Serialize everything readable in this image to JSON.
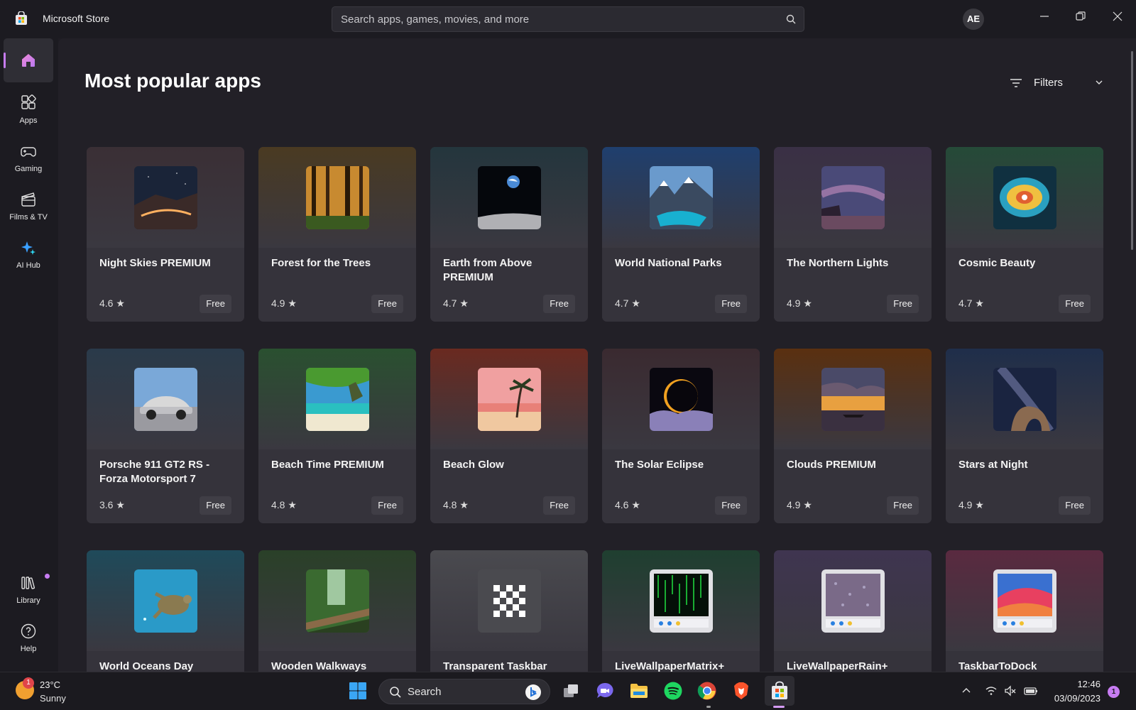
{
  "app": {
    "title": "Microsoft Store",
    "search_placeholder": "Search apps, games, movies, and more",
    "user_initials": "AE"
  },
  "sidebar": {
    "items": [
      {
        "label": "",
        "icon": "home-icon",
        "active": true
      },
      {
        "label": "Apps",
        "icon": "apps-icon"
      },
      {
        "label": "Gaming",
        "icon": "gamepad-icon"
      },
      {
        "label": "Films & TV",
        "icon": "film-icon"
      },
      {
        "label": "AI Hub",
        "icon": "sparkle-icon"
      }
    ],
    "bottom_items": [
      {
        "label": "Library",
        "icon": "library-icon"
      },
      {
        "label": "Help",
        "icon": "help-icon"
      }
    ],
    "accent": "#c77cf2"
  },
  "main": {
    "title": "Most popular apps",
    "filters_label": "Filters",
    "cards": [
      {
        "name": "Night Skies PREMIUM",
        "rating": "4.6",
        "price": "Free",
        "thumb": "night-skies-thumb",
        "bg": "#3a2f35"
      },
      {
        "name": "Forest for the Trees",
        "rating": "4.9",
        "price": "Free",
        "thumb": "forest-thumb",
        "bg": "#4a3a22"
      },
      {
        "name": "Earth from Above PREMIUM",
        "rating": "4.7",
        "price": "Free",
        "thumb": "earth-thumb",
        "bg": "#24363d"
      },
      {
        "name": "World National Parks",
        "rating": "4.7",
        "price": "Free",
        "thumb": "national-parks-thumb",
        "bg": "#1f3f6e"
      },
      {
        "name": "The Northern Lights",
        "rating": "4.9",
        "price": "Free",
        "thumb": "northern-lights-thumb",
        "bg": "#3a3045"
      },
      {
        "name": "Cosmic Beauty",
        "rating": "4.7",
        "price": "Free",
        "thumb": "cosmic-thumb",
        "bg": "#254a38"
      },
      {
        "name": "Porsche 911 GT2 RS - Forza Motorsport 7",
        "rating": "3.6",
        "price": "Free",
        "thumb": "porsche-thumb",
        "bg": "#2a3a4a"
      },
      {
        "name": "Beach Time PREMIUM",
        "rating": "4.8",
        "price": "Free",
        "thumb": "beach-time-thumb",
        "bg": "#2a5030"
      },
      {
        "name": "Beach Glow",
        "rating": "4.8",
        "price": "Free",
        "thumb": "beach-glow-thumb",
        "bg": "#6a2a20"
      },
      {
        "name": "The Solar Eclipse",
        "rating": "4.6",
        "price": "Free",
        "thumb": "solar-eclipse-thumb",
        "bg": "#3a2a30"
      },
      {
        "name": "Clouds PREMIUM",
        "rating": "4.9",
        "price": "Free",
        "thumb": "clouds-thumb",
        "bg": "#5a3010"
      },
      {
        "name": "Stars at Night",
        "rating": "4.9",
        "price": "Free",
        "thumb": "stars-thumb",
        "bg": "#1f2e4a"
      },
      {
        "name": "World Oceans Day",
        "rating": "",
        "price": "",
        "thumb": "oceans-thumb",
        "bg": "#1f4a5a"
      },
      {
        "name": "Wooden Walkways",
        "rating": "",
        "price": "",
        "thumb": "walkways-thumb",
        "bg": "#2a4028"
      },
      {
        "name": "Transparent Taskbar",
        "rating": "",
        "price": "",
        "thumb": "checker-thumb",
        "bg": "#4a4a4f"
      },
      {
        "name": "LiveWallpaperMatrix+",
        "rating": "",
        "price": "",
        "thumb": "matrix-thumb",
        "bg": "#1f3f30"
      },
      {
        "name": "LiveWallpaperRain+",
        "rating": "",
        "price": "",
        "thumb": "rain-thumb",
        "bg": "#3f3550"
      },
      {
        "name": "TaskbarToDock",
        "rating": "",
        "price": "",
        "thumb": "dock-thumb",
        "bg": "#5a2a40"
      }
    ]
  },
  "taskbar": {
    "weather_badge": "1",
    "temperature": "23°C",
    "condition": "Sunny",
    "search_label": "Search",
    "time": "12:46",
    "date": "03/09/2023",
    "notification_count": "1"
  }
}
